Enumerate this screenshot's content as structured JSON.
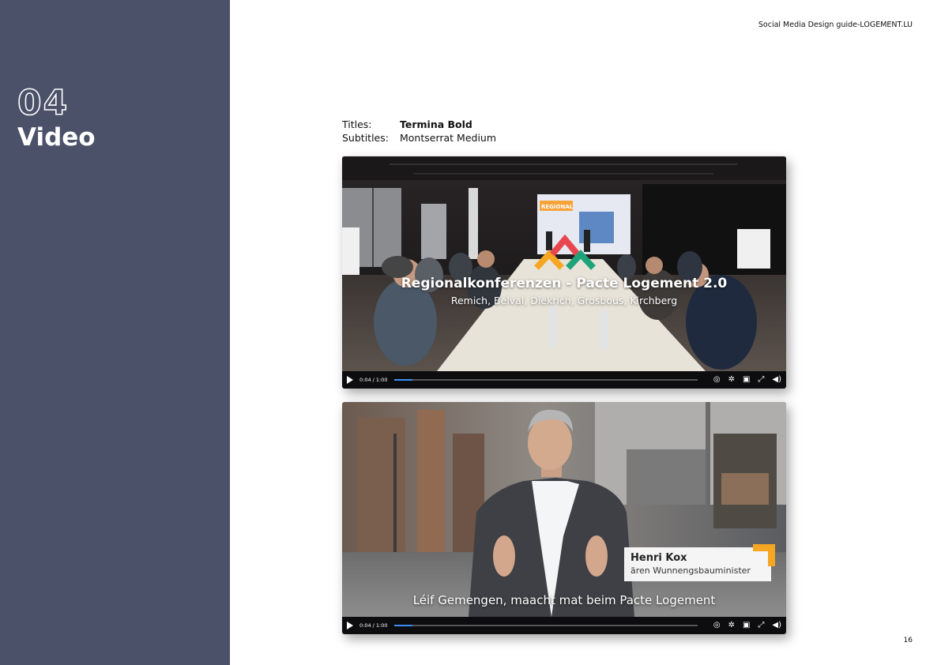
{
  "header": {
    "doc_title": "Social Media Design guide-LOGEMENT.LU"
  },
  "section": {
    "number": "04",
    "title": "Video"
  },
  "fonts": {
    "titles_label": "Titles:",
    "titles_value": "Termina Bold",
    "subtitles_label": "Subtitles:",
    "subtitles_value": "Montserrat Medium"
  },
  "video1": {
    "title": "Regionalkonferenzen - Pacte Logement 2.0",
    "subtitle": "Remich, Belval, Diekrich, Grosbous, Kirchberg",
    "screen_text": "REGIONAL",
    "time": "0:04 / 1:00",
    "progress": 0.06
  },
  "video2": {
    "name": "Henri Kox",
    "role": "ären Wunnengsbauminister",
    "caption": "Léif Gemengen, maacht mat beim Pacte Logement",
    "time": "0:04 / 1:00",
    "progress": 0.06
  },
  "icons": {
    "play": "play-icon",
    "chat": "chat-icon",
    "settings": "gear-icon",
    "pip": "picture-in-picture-icon",
    "fullscreen": "fullscreen-icon",
    "volume": "volume-icon"
  },
  "colors": {
    "sidebar": "#4a5168",
    "progress": "#3a8df5",
    "accent_orange": "#f5a623",
    "logo_red": "#e8464f",
    "logo_green": "#1fa37a"
  },
  "page": {
    "number": "16"
  }
}
